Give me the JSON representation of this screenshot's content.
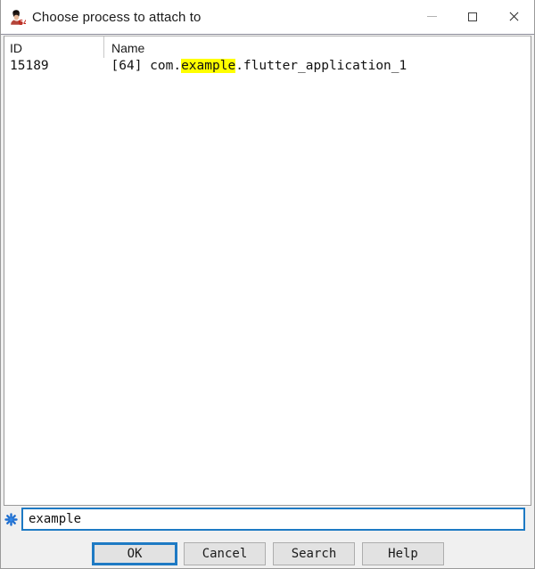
{
  "window": {
    "title": "Choose process to attach to",
    "icon": "process-avatar-64-icon",
    "controls": {
      "minimize": "minimize-icon",
      "maximize": "maximize-icon",
      "close": "close-icon"
    }
  },
  "process_table": {
    "columns": [
      "ID",
      "Name"
    ],
    "rows": [
      {
        "id": "15189",
        "name_prefix": "[64] com.",
        "name_highlight": "example",
        "name_suffix": ".flutter_application_1"
      }
    ]
  },
  "filter": {
    "icon": "filter-asterisk-icon",
    "value": "example",
    "placeholder": ""
  },
  "buttons": {
    "ok": "OK",
    "cancel": "Cancel",
    "search": "Search",
    "help": "Help"
  },
  "colors": {
    "focus_blue": "#1e7ac4",
    "highlight_yellow": "#ffff00",
    "window_bg": "#f0f0f0",
    "list_bg": "#ffffff"
  }
}
